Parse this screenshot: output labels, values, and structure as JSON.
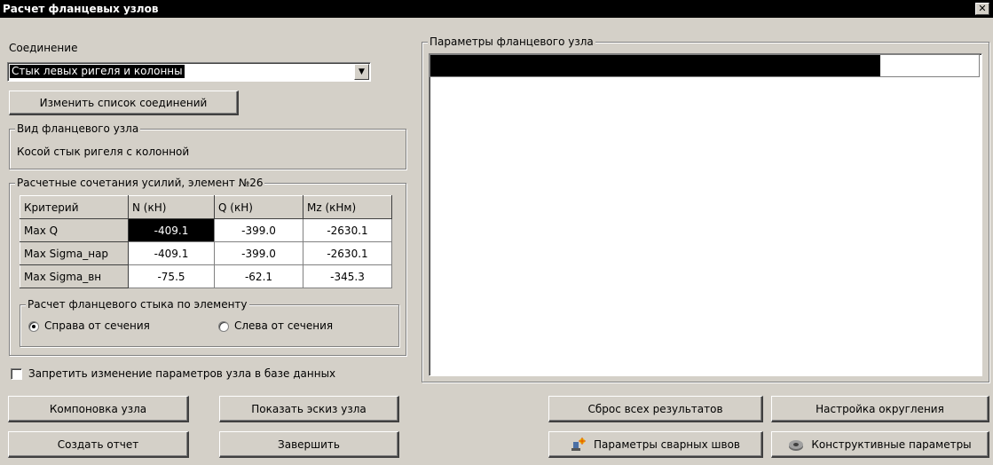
{
  "window": {
    "title": "Расчет фланцевых узлов",
    "close_glyph": "✕"
  },
  "connection": {
    "label": "Соединение",
    "selected": "Стык левых ригеля и колонны",
    "change_list_button": "Изменить список соединений"
  },
  "node_type": {
    "group_title": "Вид фланцевого узла",
    "value": "Косой стык ригеля с колонной"
  },
  "combinations": {
    "group_title": "Расчетные сочетания усилий, элемент №26",
    "columns": [
      "Критерий",
      "N (кН)",
      "Q (кН)",
      "Mz (кНм)"
    ],
    "rows": [
      [
        "Max Q",
        "-409.1",
        "-399.0",
        "-2630.1"
      ],
      [
        "Max Sigma_нар",
        "-409.1",
        "-399.0",
        "-2630.1"
      ],
      [
        "Max Sigma_вн",
        "-75.5",
        "-62.1",
        "-345.3"
      ]
    ]
  },
  "flange_calc": {
    "group_title": "Расчет фланцевого стыка по элементу",
    "option_right": "Справа от сечения",
    "option_left": "Слева от сечения",
    "selected": "right"
  },
  "lock_checkbox": {
    "label": "Запретить изменение параметров узла в базе данных",
    "checked": false
  },
  "params_panel": {
    "group_title": "Параметры фланцевого узла",
    "progress": 0.82
  },
  "buttons": {
    "layout": "Компоновка узла",
    "show_sketch": "Показать эскиз узла",
    "create_report": "Создать отчет",
    "finish": "Завершить",
    "reset_results": "Сброс всех результатов",
    "rounding": "Настройка округления",
    "weld_params": "Параметры сварных швов",
    "design_params": "Конструктивные параметры"
  },
  "icons": {
    "weld": "weld-params-icon",
    "design": "design-params-icon"
  }
}
